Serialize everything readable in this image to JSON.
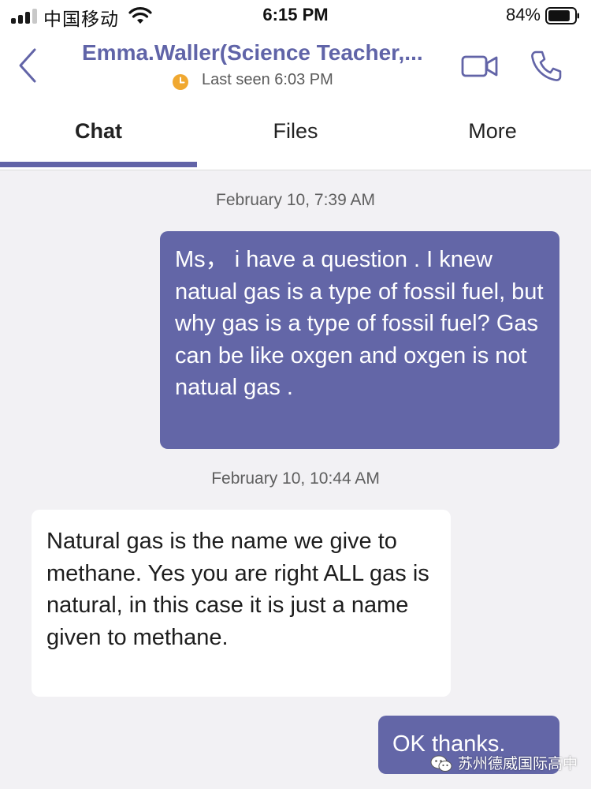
{
  "status_bar": {
    "carrier": "中国移动",
    "time": "6:15 PM",
    "battery_percent": "84%",
    "battery_level": 0.84,
    "signal_bars": 3,
    "icons": [
      "signal-icon",
      "wifi-icon",
      "battery-icon"
    ]
  },
  "header": {
    "contact_name": "Emma.Waller(Science Teacher,...",
    "presence": "Last seen 6:03 PM",
    "presence_color": "#f0a830",
    "name_color": "#6064a8",
    "icons": [
      "back-chevron-icon",
      "clock-icon",
      "video-camera-icon",
      "phone-icon"
    ]
  },
  "tabs": [
    {
      "label": "Chat",
      "active": true
    },
    {
      "label": "Files",
      "active": false
    },
    {
      "label": "More",
      "active": false
    }
  ],
  "accent_color": "#6264a7",
  "messages": [
    {
      "timestamp": "February 10, 7:39 AM",
      "direction": "outgoing",
      "text": "Ms， i have a question . I knew natual gas is a type of fossil fuel,  but  why gas is a type of fossil fuel? Gas can be like oxgen and oxgen is not natual gas ."
    },
    {
      "timestamp": "February 10, 10:44 AM",
      "direction": "incoming",
      "text": "Natural gas is the name we give to methane. Yes you are right ALL gas is natural, in this case it is just a name given to methane."
    },
    {
      "direction": "outgoing",
      "text": "OK    thanks."
    }
  ],
  "watermark": {
    "text": "苏州德威国际高中",
    "icon": "wechat-icon"
  }
}
